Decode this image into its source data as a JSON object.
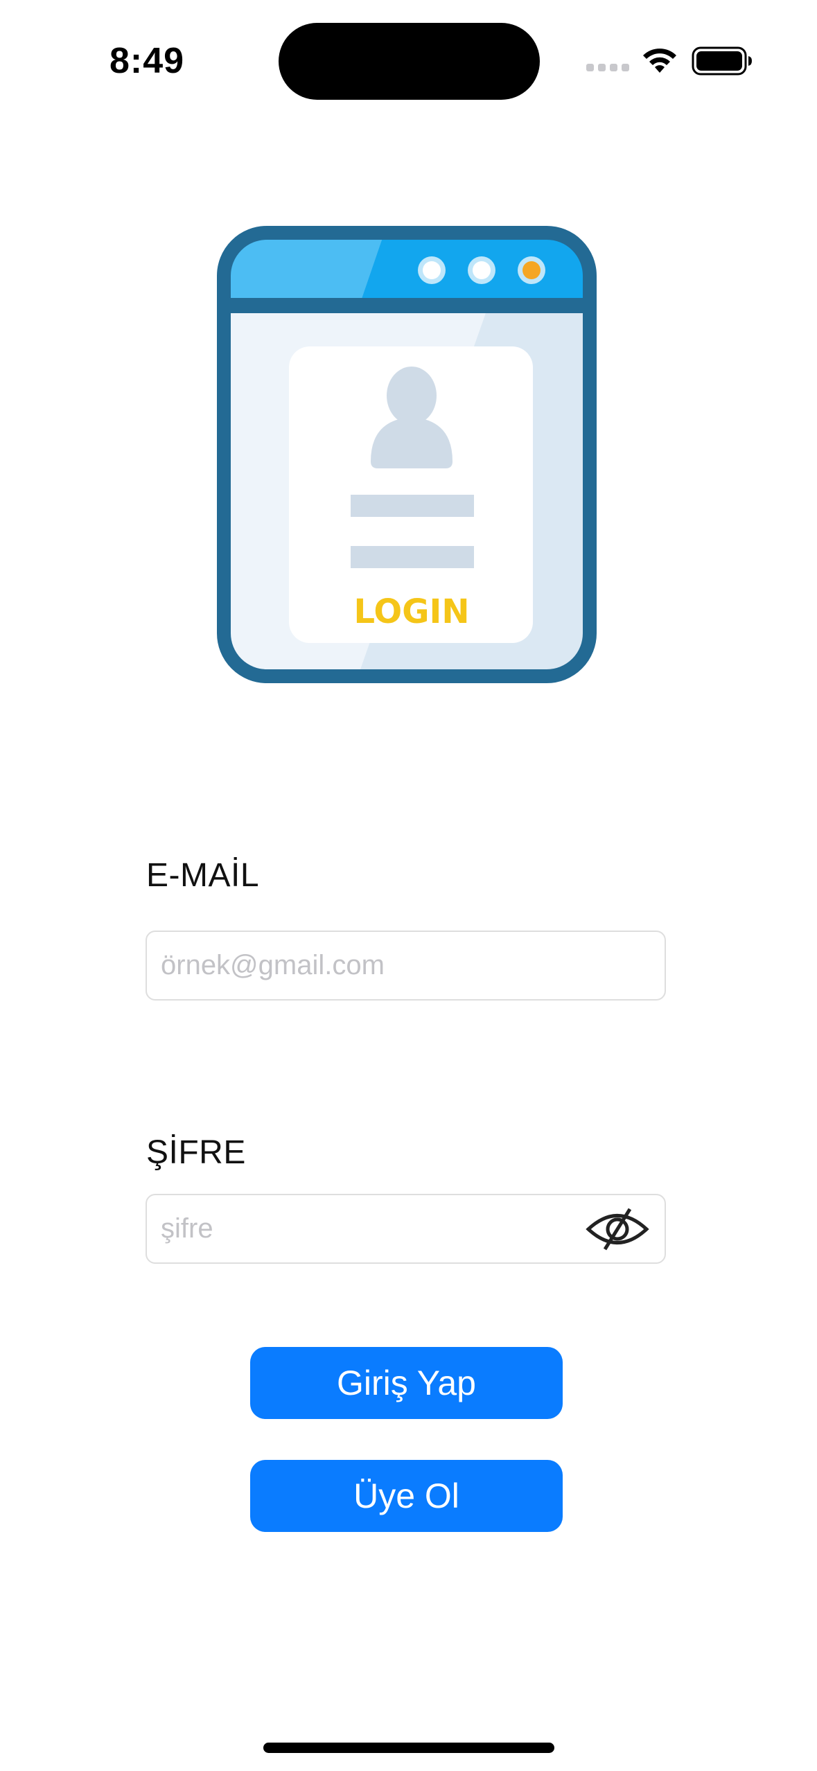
{
  "status_bar": {
    "time": "8:49"
  },
  "illustration": {
    "caption": "LOGIN",
    "colors": {
      "frame": "#236a94",
      "titlebar": "#4cbdf3",
      "window_bg": "#eef4fa",
      "card": "#ffffff",
      "placeholder_shape": "#cfdbe7",
      "caption": "#f5c518",
      "dot_active": "#f5a623"
    }
  },
  "form": {
    "email": {
      "label": "E-MAİL",
      "placeholder": "örnek@gmail.com",
      "value": ""
    },
    "password": {
      "label": "ŞİFRE",
      "placeholder": "şifre",
      "value": "",
      "toggle_icon": "eye-slash-icon"
    }
  },
  "buttons": {
    "login_label": "Giriş Yap",
    "signup_label": "Üye Ol",
    "color": "#0a7cff"
  }
}
